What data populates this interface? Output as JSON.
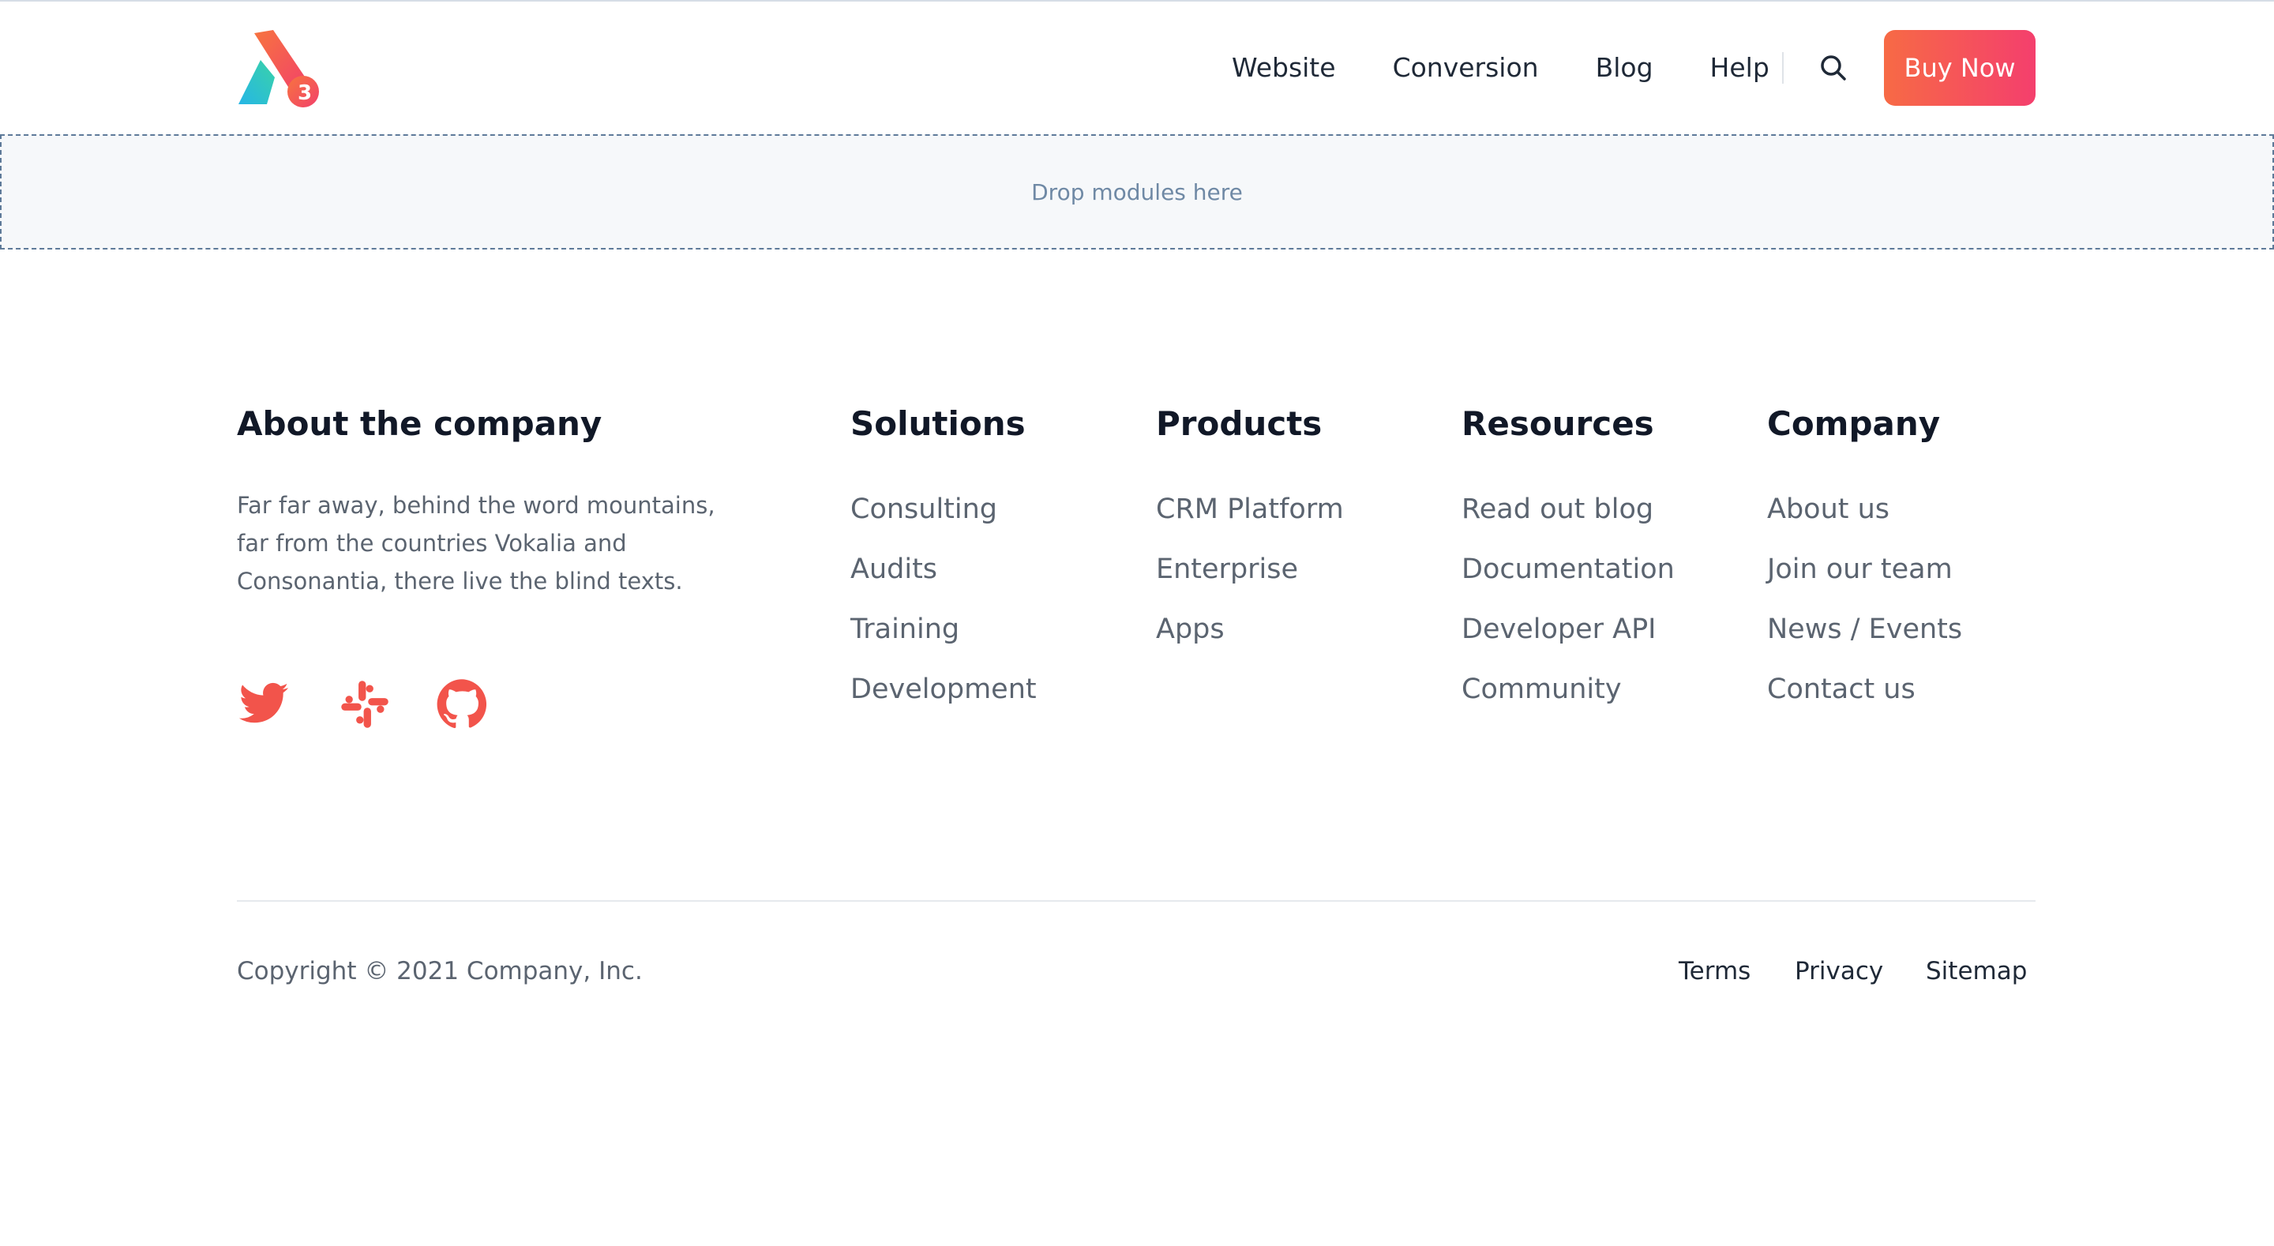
{
  "header": {
    "nav": [
      "Website",
      "Conversion",
      "Blog",
      "Help"
    ],
    "buy_label": "Buy Now",
    "logo_icon": "a3-logo-icon",
    "search_icon": "search-icon"
  },
  "dropzone": {
    "text": "Drop modules here"
  },
  "about": {
    "heading": "About the company",
    "text": "Far far away, behind the word mountains, far from the countries Vokalia and Consonantia, there live the blind texts.",
    "social_icons": [
      "twitter-icon",
      "slack-icon",
      "github-icon"
    ]
  },
  "columns": [
    {
      "heading": "Solutions",
      "links": [
        "Consulting",
        "Audits",
        "Training",
        "Development"
      ]
    },
    {
      "heading": "Products",
      "links": [
        "CRM Platform",
        "Enterprise",
        "Apps"
      ]
    },
    {
      "heading": "Resources",
      "links": [
        "Read out blog",
        "Documentation",
        "Developer API",
        "Community"
      ]
    },
    {
      "heading": "Company",
      "links": [
        "About us",
        "Join our team",
        "News / Events",
        "Contact us"
      ]
    }
  ],
  "bottom": {
    "copyright": "Copyright © 2021 Company, Inc.",
    "links": [
      "Terms",
      "Privacy",
      "Sitemap"
    ]
  },
  "colors": {
    "accent_start": "#f76a45",
    "accent_end": "#f43f6d",
    "social": "#f2544b"
  }
}
